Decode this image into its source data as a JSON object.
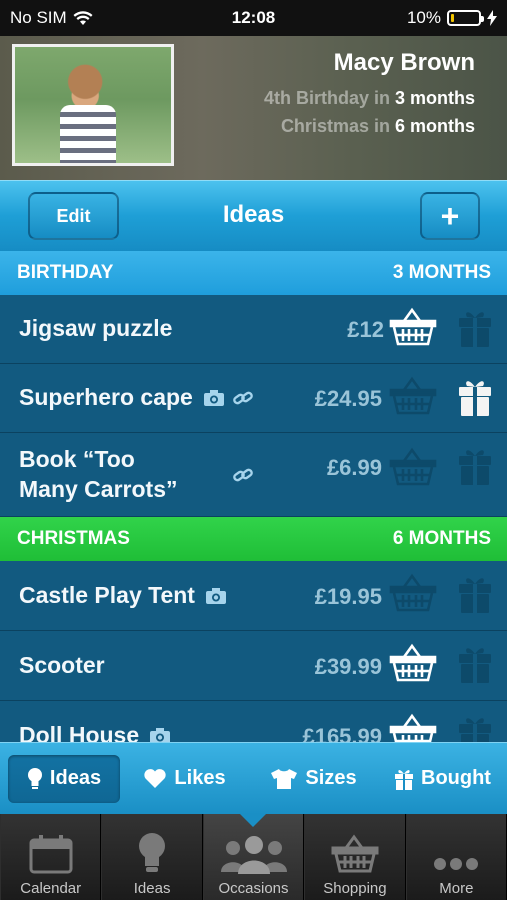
{
  "status": {
    "carrier": "No SIM",
    "time": "12:08",
    "battery": "10%"
  },
  "profile": {
    "name": "Macy Brown",
    "occasions": [
      {
        "prefix": "4th Birthday in",
        "value": "3 months"
      },
      {
        "prefix": "Christmas in",
        "value": "6 months"
      }
    ]
  },
  "nav": {
    "edit": "Edit",
    "title": "Ideas",
    "add": "+"
  },
  "sections": {
    "birthday": {
      "name": "BIRTHDAY",
      "time": "3 MONTHS"
    },
    "christmas": {
      "name": "CHRISTMAS",
      "time": "6 MONTHS"
    }
  },
  "rows": [
    {
      "label": "Jigsaw puzzle",
      "price": "£12",
      "bought": false
    },
    {
      "label": "Superhero cape",
      "price": "£24.95",
      "bought": true
    },
    {
      "label": "Book “Too",
      "label2": "Many Carrots”",
      "price": "£6.99",
      "bought": false
    },
    {
      "label": "Castle Play Tent",
      "price": "£19.95",
      "bought": false
    },
    {
      "label": "Scooter",
      "price": "£39.99",
      "bought": false
    },
    {
      "label": "Doll House",
      "price": "£165.99",
      "bought": false
    }
  ],
  "segments": [
    "Ideas",
    "Likes",
    "Sizes",
    "Bought"
  ],
  "tabs": [
    "Calendar",
    "Ideas",
    "Occasions",
    "Shopping",
    "More"
  ],
  "colors": {
    "accent": "#1e9fd6",
    "christmas": "#22c23b",
    "row": "#125a80",
    "battery": "#f2c400"
  }
}
